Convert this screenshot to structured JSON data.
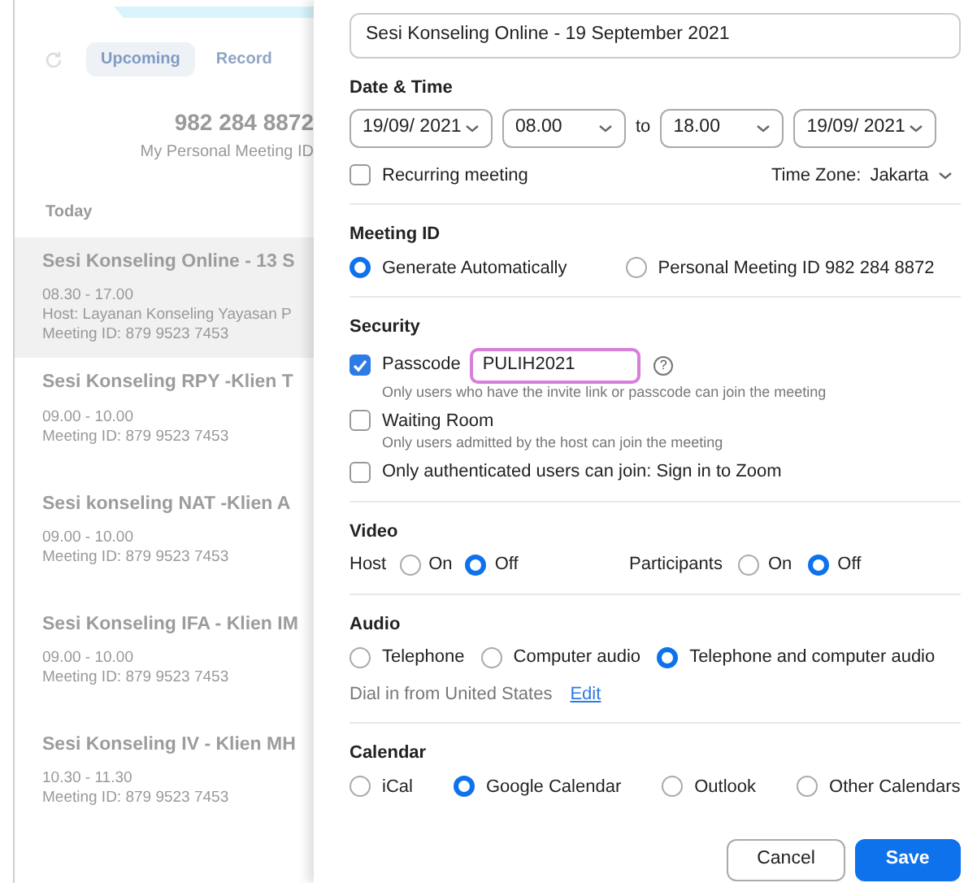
{
  "background": {
    "tabs": [
      {
        "label": "Upcoming",
        "selected": true
      },
      {
        "label": "Record",
        "selected": false
      }
    ],
    "personal_id": "982 284 8872",
    "personal_id_caption": "My Personal Meeting ID",
    "section": "Today",
    "meetings": [
      {
        "title": "Sesi Konseling Online - 13 S",
        "time": "08.30 - 17.00",
        "host": "Host: Layanan Konseling Yayasan P",
        "meeting_id": "Meeting ID: 879 9523 7453",
        "selected": true
      },
      {
        "title": "Sesi Konseling RPY -Klien T",
        "time": "09.00 - 10.00",
        "meeting_id": "Meeting ID: 879 9523 7453",
        "selected": false
      },
      {
        "title": "Sesi konseling NAT -Klien A",
        "time": "09.00 - 10.00",
        "meeting_id": "Meeting ID: 879 9523 7453",
        "selected": false
      },
      {
        "title": "Sesi Konseling IFA - Klien IM",
        "time": "09.00 - 10.00",
        "meeting_id": "Meeting ID: 879 9523 7453",
        "selected": false
      },
      {
        "title": "Sesi Konseling IV - Klien MH",
        "time": "10.30 - 11.30",
        "meeting_id": "Meeting ID: 879 9523 7453",
        "selected": false
      }
    ]
  },
  "dialog": {
    "topic": "Sesi Konseling Online - 19 September 2021",
    "date_time": {
      "heading": "Date & Time",
      "start_date": "19/09/ 2021",
      "start_time": "08.00",
      "to": "to",
      "end_time": "18.00",
      "end_date": "19/09/ 2021",
      "recurring": {
        "label": "Recurring meeting",
        "checked": false
      },
      "time_zone_label": "Time Zone:",
      "time_zone": "Jakarta"
    },
    "meeting_id": {
      "heading": "Meeting ID",
      "options": [
        {
          "label": "Generate Automatically",
          "selected": true
        },
        {
          "label": "Personal Meeting ID 982 284 8872",
          "selected": false
        }
      ]
    },
    "security": {
      "heading": "Security",
      "options": [
        {
          "label": "Passcode",
          "checked": true,
          "value": "PULIH2021",
          "help": "?",
          "hint": "Only users who have the invite link or passcode can join the meeting"
        },
        {
          "label": "Waiting Room",
          "checked": false,
          "hint": "Only users admitted by the host can join the meeting"
        },
        {
          "label": "Only authenticated users can join: Sign in to Zoom",
          "checked": false
        }
      ]
    },
    "video": {
      "heading": "Video",
      "groups": [
        {
          "label": "Host",
          "options": [
            {
              "label": "On",
              "selected": false
            },
            {
              "label": "Off",
              "selected": true
            }
          ]
        },
        {
          "label": "Participants",
          "options": [
            {
              "label": "On",
              "selected": false
            },
            {
              "label": "Off",
              "selected": true
            }
          ]
        }
      ]
    },
    "audio": {
      "heading": "Audio",
      "options": [
        {
          "label": "Telephone",
          "selected": false
        },
        {
          "label": "Computer audio",
          "selected": false
        },
        {
          "label": "Telephone and computer audio",
          "selected": true
        }
      ],
      "dial_in": "Dial in from United States",
      "edit_link": "Edit"
    },
    "calendar": {
      "heading": "Calendar",
      "options": [
        {
          "label": "iCal",
          "selected": false
        },
        {
          "label": "Google Calendar",
          "selected": true
        },
        {
          "label": "Outlook",
          "selected": false
        },
        {
          "label": "Other Calendars",
          "selected": false
        }
      ]
    },
    "buttons": [
      {
        "label": "Cancel",
        "kind": "secondary"
      },
      {
        "label": "Save",
        "kind": "primary"
      }
    ]
  }
}
